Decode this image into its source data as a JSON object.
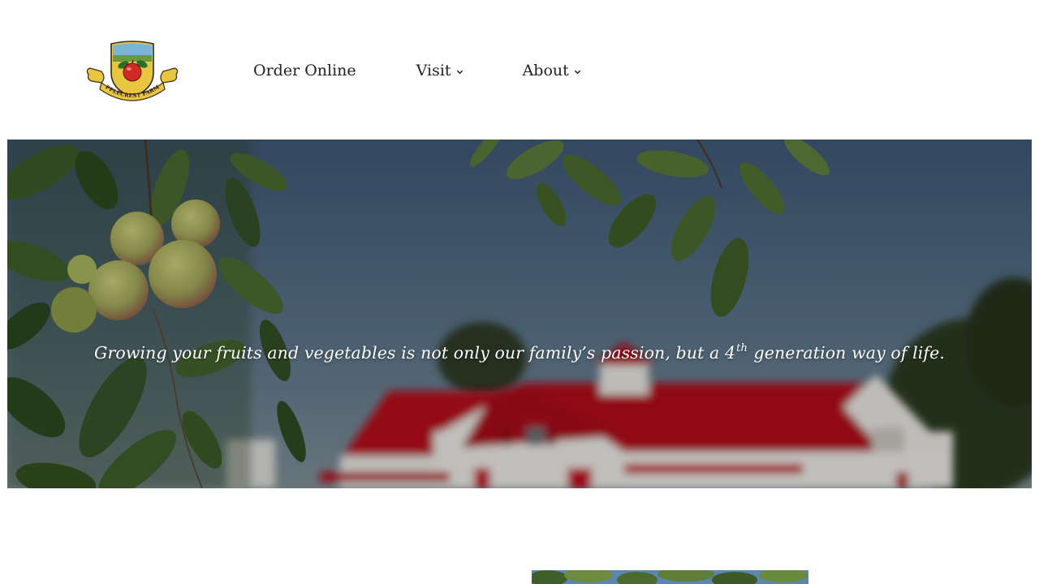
{
  "header": {
    "logo": {
      "alt_text": "APPLECREST FARMS",
      "icon": "applecrest-crest-logo"
    },
    "nav": {
      "order_online_label": "Order Online",
      "visit_label": "Visit",
      "about_label": "About"
    }
  },
  "hero": {
    "tagline_main": "Growing your fruits and vegetables is not only our family’s passion, but a 4",
    "tagline_sup": "th",
    "tagline_end": " generation way of life."
  },
  "colors": {
    "barn_roof": "#b8101f",
    "sky": "#4a6480",
    "leaf": "#3d5a2a",
    "apple": "#a8b060",
    "logo_gold": "#e8c640",
    "logo_red": "#d12a22"
  }
}
